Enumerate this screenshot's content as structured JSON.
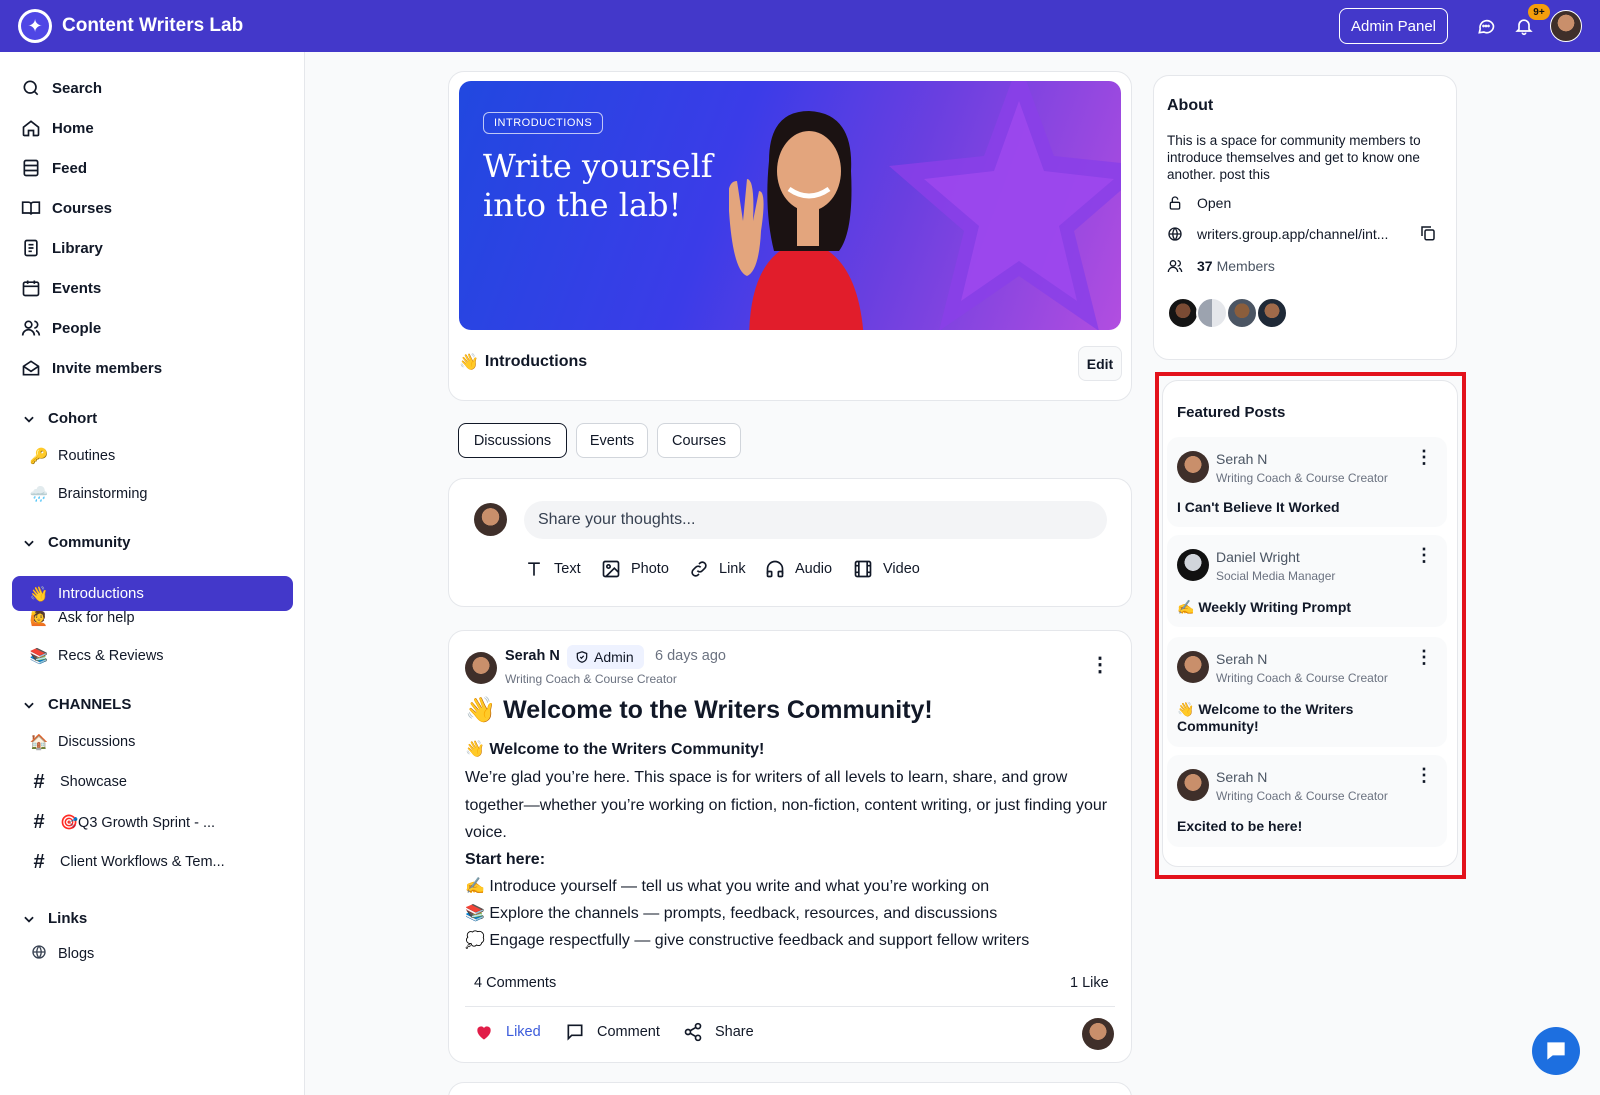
{
  "app": {
    "title": "Content Writers Lab",
    "admin_panel": "Admin Panel",
    "notif_count": "9+"
  },
  "sidebar": {
    "nav": [
      {
        "label": "Search",
        "icon": "search-icon"
      },
      {
        "label": "Home",
        "icon": "home-icon"
      },
      {
        "label": "Feed",
        "icon": "feed-icon"
      },
      {
        "label": "Courses",
        "icon": "book-icon"
      },
      {
        "label": "Library",
        "icon": "library-icon"
      },
      {
        "label": "Events",
        "icon": "calendar-icon"
      },
      {
        "label": "People",
        "icon": "people-icon"
      },
      {
        "label": "Invite members",
        "icon": "mail-icon"
      }
    ],
    "cohort": {
      "title": "Cohort",
      "items": [
        {
          "emoji": "🔑",
          "label": "Routines"
        },
        {
          "emoji": "🌧️",
          "label": "Brainstorming"
        }
      ]
    },
    "community": {
      "title": "Community",
      "items": [
        {
          "emoji": "👋",
          "label": "Introductions"
        },
        {
          "emoji": "🙋",
          "label": "Ask for help"
        },
        {
          "emoji": "📚",
          "label": "Recs & Reviews"
        }
      ]
    },
    "channels": {
      "title": "CHANNELS",
      "items": [
        {
          "emoji": "🏠",
          "label": "Discussions"
        },
        {
          "label": "Showcase"
        },
        {
          "label": "🎯Q3 Growth Sprint - ..."
        },
        {
          "label": "Client Workflows & Tem..."
        }
      ]
    },
    "links": {
      "title": "Links",
      "items": [
        {
          "label": "Blogs"
        }
      ]
    }
  },
  "banner": {
    "tag": "INTRODUCTIONS",
    "title": "Write yourself into the lab!"
  },
  "space": {
    "emoji": "👋",
    "name": "Introductions",
    "edit": "Edit"
  },
  "tabs": [
    "Discussions",
    "Events",
    "Courses"
  ],
  "composer": {
    "placeholder": "Share your thoughts...",
    "options": [
      "Text",
      "Photo",
      "Link",
      "Audio",
      "Video"
    ]
  },
  "post": {
    "author": "Serah N",
    "badge": "Admin",
    "time": "6 days ago",
    "role": "Writing Coach & Course Creator",
    "title": "👋 Welcome to the Writers Community!",
    "subtitle": "👋 Welcome to the Writers Community!",
    "intro": "We’re glad you’re here. This space is for writers of all levels to learn, share, and grow together—whether you’re working on fiction, non-fiction, content writing, or just finding your voice.",
    "start": "Start here:",
    "bullets": [
      "✍️ Introduce yourself — tell us what you write and what you’re working on",
      "📚 Explore the channels — prompts, feedback, resources, and discussions",
      "💭 Engage respectfully — give constructive feedback and support fellow writers"
    ],
    "comments": "4 Comments",
    "likes": "1 Like",
    "actions": {
      "liked": "Liked",
      "comment": "Comment",
      "share": "Share"
    }
  },
  "about": {
    "title": "About",
    "description": "This is a space for community members to introduce themselves and get to know one another. post this",
    "access": "Open",
    "url": "writers.group.app/channel/int...",
    "member_count": "37",
    "members_label": "Members"
  },
  "featured": {
    "title": "Featured Posts",
    "posts": [
      {
        "author": "Serah N",
        "role": "Writing Coach & Course Creator",
        "title": "I Can't Believe It Worked"
      },
      {
        "author": "Daniel Wright",
        "role": "Social Media Manager",
        "title": "✍️ Weekly Writing Prompt"
      },
      {
        "author": "Serah N",
        "role": "Writing Coach & Course Creator",
        "title": "👋 Welcome to the Writers Community!"
      },
      {
        "author": "Serah N",
        "role": "Writing Coach & Course Creator",
        "title": "Excited to be here!"
      }
    ]
  },
  "colors": {
    "brand": "#4338ca",
    "highlight": "#e3121b",
    "like": "#e11d48",
    "fab": "#1d6fe0"
  }
}
